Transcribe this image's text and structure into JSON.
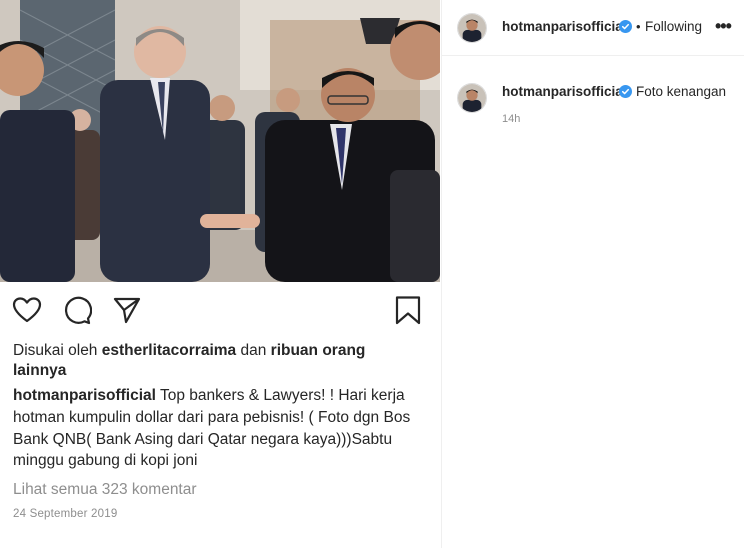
{
  "post": {
    "username": "hotmanparisofficial",
    "separator": "•",
    "follow_status": "Following",
    "more_icon": "•••",
    "likes": {
      "prefix": "Disukai oleh",
      "user": "estherlitacorraima",
      "connector": "dan",
      "others": "ribuan orang lainnya"
    },
    "caption": {
      "user": "hotmanparisofficial",
      "text": "Top bankers & Lawyers! ! Hari kerja hotman kumpulin dollar dari para pebisnis! ( Foto dgn Bos Bank QNB( Bank Asing dari Qatar negara kaya)))Sabtu minggu gabung di kopi joni"
    },
    "view_comments": "Lihat semua 323 komentar",
    "date": "24 September 2019"
  },
  "comment": {
    "username": "hotmanparisofficial",
    "text": "Foto kenangan",
    "time": "14h"
  },
  "icons": {
    "like": "heart-icon",
    "comment": "comment-icon",
    "share": "send-icon",
    "save": "bookmark-icon",
    "verified": "verified-badge-icon"
  },
  "colors": {
    "verified": "#3897f0",
    "muted": "#8e8e8e",
    "text": "#262626"
  }
}
